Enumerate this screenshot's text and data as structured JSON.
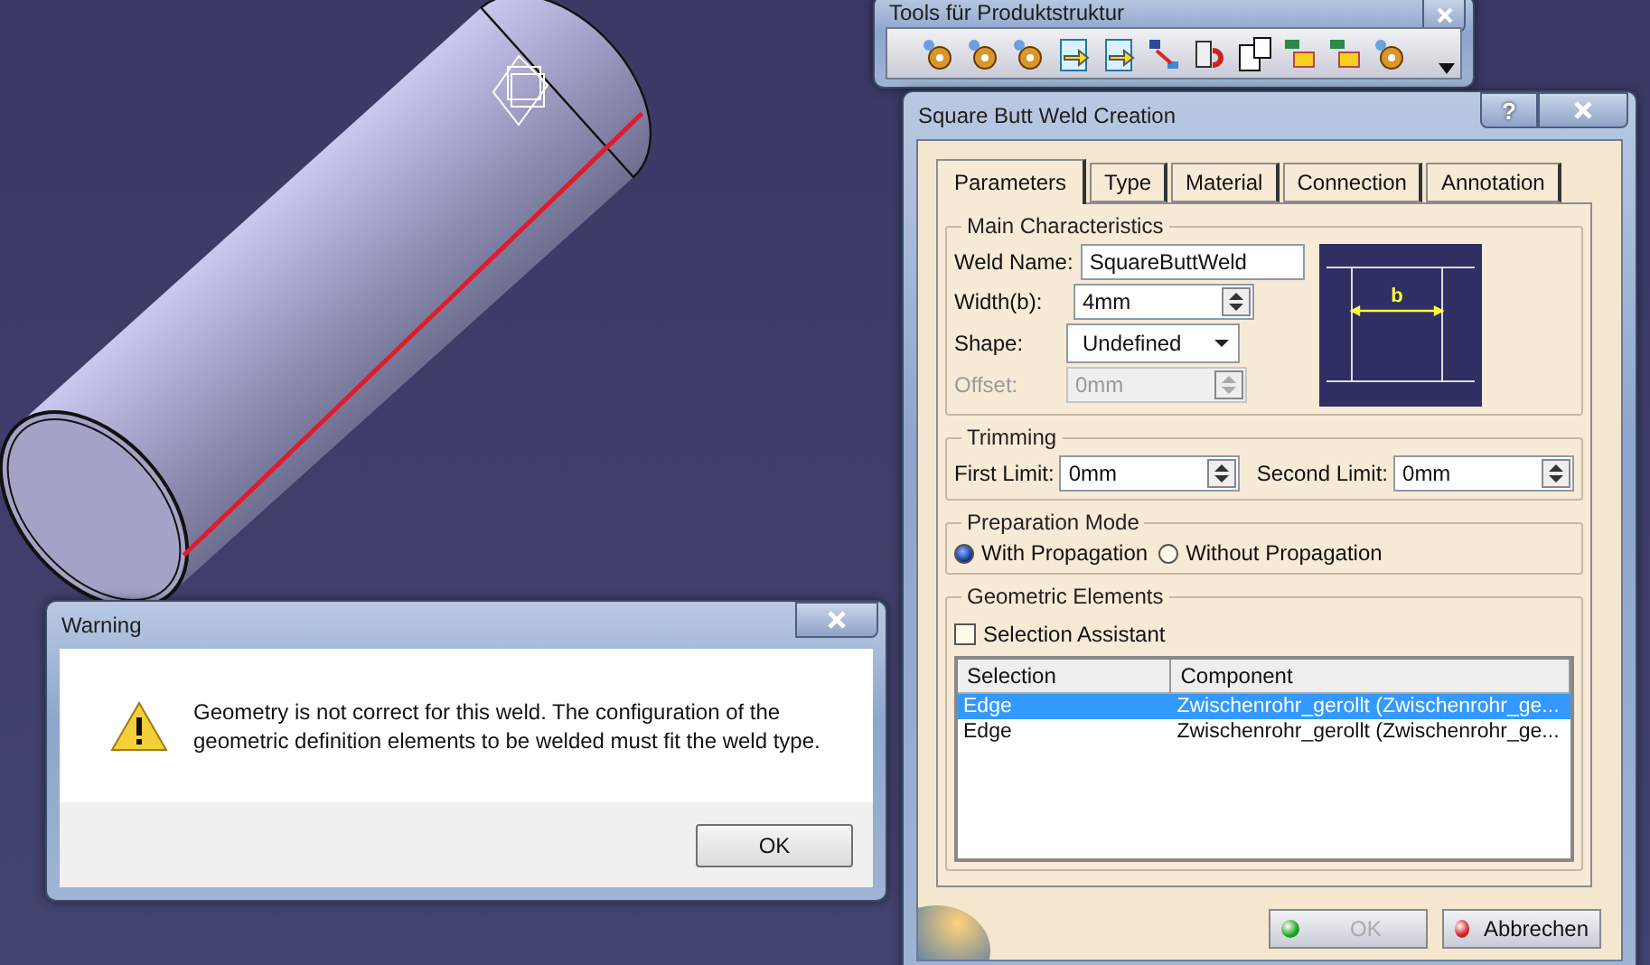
{
  "toolbar": {
    "title": "Tools für Produktstruktur"
  },
  "dialog": {
    "title": "Square Butt Weld Creation",
    "help": "?",
    "tabs": [
      {
        "label": "Parameters",
        "selected": true
      },
      {
        "label": "Type",
        "selected": false
      },
      {
        "label": "Material",
        "selected": false
      },
      {
        "label": "Connection",
        "selected": false
      },
      {
        "label": "Annotation",
        "selected": false
      }
    ],
    "main_characteristics": {
      "title": "Main Characteristics",
      "weld_name": {
        "label": "Weld Name:",
        "value": "SquareButtWeld"
      },
      "width": {
        "label": "Width(b):",
        "value": "4mm"
      },
      "shape": {
        "label": "Shape:",
        "value": "Undefined"
      },
      "offset": {
        "label": "Offset:",
        "value": "0mm",
        "disabled": true
      },
      "diagram_label": "b"
    },
    "trimming": {
      "title": "Trimming",
      "first_limit": {
        "label": "First Limit:",
        "value": "0mm"
      },
      "second_limit": {
        "label": "Second Limit:",
        "value": "0mm"
      }
    },
    "preparation_mode": {
      "title": "Preparation Mode",
      "options": [
        {
          "label": "With Propagation",
          "selected": true
        },
        {
          "label": "Without Propagation",
          "selected": false
        }
      ]
    },
    "geometric_elements": {
      "title": "Geometric Elements",
      "selection_assistant": {
        "label": "Selection Assistant",
        "checked": false
      },
      "table": {
        "columns": [
          "Selection",
          "Component"
        ],
        "rows": [
          {
            "cells": [
              "Edge",
              "Zwischenrohr_gerollt (Zwischenrohr_ge..."
            ],
            "selected": true
          },
          {
            "cells": [
              "Edge",
              "Zwischenrohr_gerollt (Zwischenrohr_ge..."
            ],
            "selected": false
          }
        ]
      }
    },
    "buttons": [
      {
        "kind": "ok",
        "label": "OK",
        "disabled": true
      },
      {
        "kind": "cancel",
        "label": "Abbrechen",
        "disabled": false
      }
    ]
  },
  "warning": {
    "title": "Warning",
    "message": "Geometry is not correct for this weld. The configuration of the geometric definition elements to be welded must fit the weld type.",
    "button": "OK"
  }
}
